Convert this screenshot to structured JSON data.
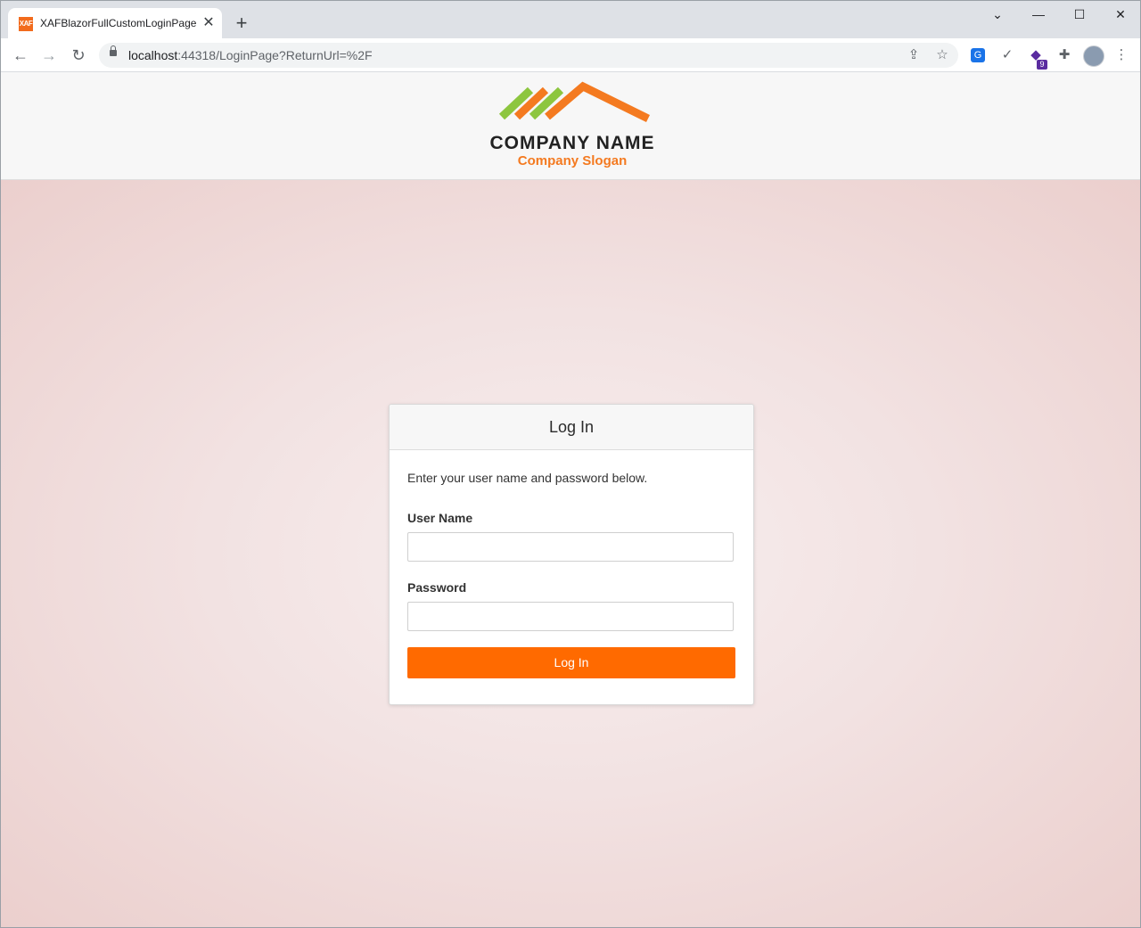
{
  "browser": {
    "tab": {
      "favicon_text": "XAF",
      "title": "XAFBlazorFullCustomLoginPage",
      "close_glyph": "✕"
    },
    "new_tab_glyph": "+",
    "window_controls": {
      "tabsearch_glyph": "⌄",
      "minimize_glyph": "—",
      "maximize_glyph": "☐",
      "close_glyph": "✕"
    },
    "nav": {
      "back_glyph": "←",
      "forward_glyph": "→",
      "reload_glyph": "↻"
    },
    "address": {
      "host": "localhost",
      "rest": ":44318/LoginPage?ReturnUrl=%2F"
    },
    "omnibox_icons": {
      "share_glyph": "⇪",
      "star_glyph": "☆"
    },
    "extensions": {
      "translate_glyph": "G",
      "check_glyph": "✓",
      "vs_glyph": "◆",
      "vs_badge": "9",
      "puzzle_glyph": "✚",
      "menu_glyph": "⋮"
    }
  },
  "header": {
    "company_name": "COMPANY NAME",
    "company_slogan": "Company Slogan",
    "logo_colors": {
      "green": "#8dc63f",
      "orange": "#f47a20"
    }
  },
  "login": {
    "title": "Log In",
    "instructions": "Enter your user name and password below.",
    "username_label": "User Name",
    "username_value": "",
    "password_label": "Password",
    "password_value": "",
    "button_label": "Log In",
    "button_color": "#ff6a00"
  }
}
